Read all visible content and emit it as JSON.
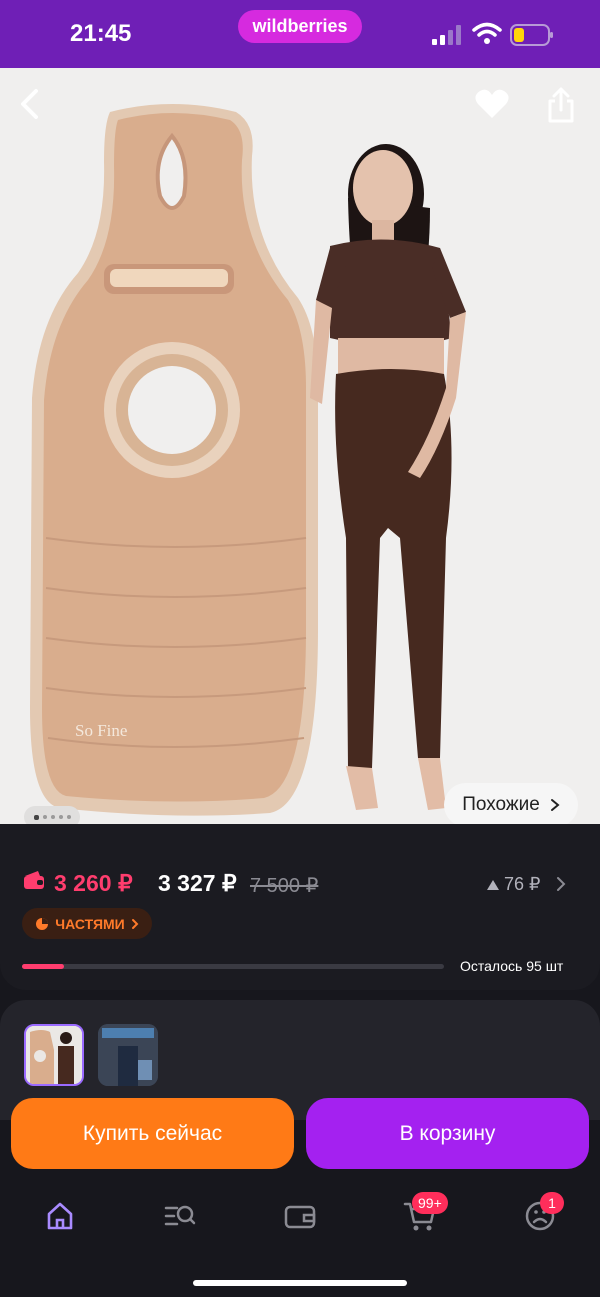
{
  "status_bar": {
    "time": "21:45",
    "brand": "wildberries"
  },
  "product": {
    "image_alt_logo": "So Fine",
    "similar_label": "Похожие",
    "gallery": {
      "index": 1,
      "count": 5
    }
  },
  "price": {
    "wallet_price": "3 260 ₽",
    "price": "3 327 ₽",
    "old_price": "7 500 ₽",
    "delta": "76 ₽",
    "installments_label": "ЧАСТЯМИ",
    "stock_text": "Осталось 95 шт",
    "stock_fraction": 0.1
  },
  "actions": {
    "buy_now": "Купить сейчас",
    "add_to_cart": "В корзину"
  },
  "nav": {
    "cart_badge": "99+",
    "profile_badge": "1"
  },
  "colors": {
    "accent_purple": "#a421f0",
    "accent_orange": "#ff7a16",
    "sale_pink": "#ff3d6e",
    "nav_active": "#a98bff"
  }
}
